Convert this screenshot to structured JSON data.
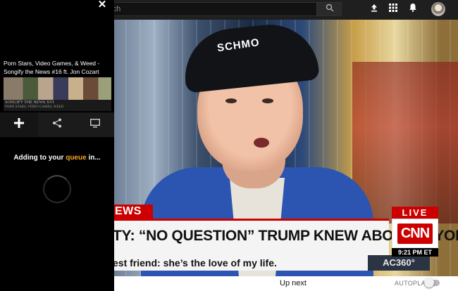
{
  "topbar": {
    "search_placeholder": "rch",
    "icons": [
      "upload-icon",
      "apps-grid-icon",
      "bell-icon",
      "avatar"
    ]
  },
  "panel": {
    "close_label": "✕",
    "video_title": "Porn Stars, Video Games, & Weed - Songify the News #16 ft. Jon Cozart",
    "thumb_caption_1": "SONGIFY THE NEWS XVI",
    "thumb_caption_2": "PORN STARS, VIDEO GAMES, WEED",
    "actions": [
      {
        "name": "add",
        "icon": "plus-icon"
      },
      {
        "name": "share",
        "icon": "share-icon"
      },
      {
        "name": "cast",
        "icon": "tv-icon"
      }
    ],
    "status_prefix": "Adding to your ",
    "status_highlight": "queue",
    "status_suffix": " in..."
  },
  "video": {
    "cap_text": "SCHMO",
    "news_tag": "EWS",
    "headline": "TY: “NO QUESTION” TRUMP KNEW ABOUT PAYOFF",
    "ticker": "est friend: she’s the love of my life.",
    "show": "AC360°",
    "live": "LIVE",
    "network": "CNN",
    "time": "9:21 PM ET"
  },
  "bottom": {
    "up_next": "Up next",
    "autoplay": "AUTOPLAY"
  },
  "colors": {
    "accent_queue": "#f5a623",
    "cnn_red": "#cc0000"
  }
}
